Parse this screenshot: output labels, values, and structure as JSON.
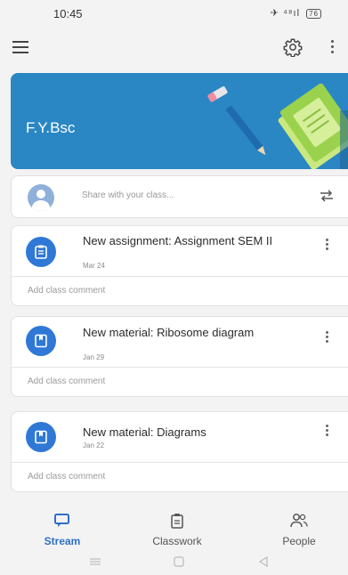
{
  "status_bar": {
    "time": "10:45",
    "signal": "✈ ⁴⁸ıl",
    "battery": "76"
  },
  "class": {
    "name": "F.Y.Bsc"
  },
  "composer": {
    "placeholder": "Share with your class..."
  },
  "posts": [
    {
      "title": "New assignment: Assignment SEM II",
      "date": "Mar 24",
      "comment": "Add class comment",
      "type": "assignment"
    },
    {
      "title": "New material: Ribosome diagram",
      "date": "Jan 29",
      "comment": "Add class comment",
      "type": "material"
    },
    {
      "title": "New material: Diagrams",
      "date": "Jan 22",
      "comment": "Add class comment",
      "type": "material"
    }
  ],
  "nav": {
    "stream": "Stream",
    "classwork": "Classwork",
    "people": "People"
  },
  "colors": {
    "accent": "#2f6fc7",
    "banner": "#2a87c4",
    "icon_bg": "#2f78d5"
  },
  "icons": [
    "menu-icon",
    "gear-icon",
    "more-vert-icon",
    "swap-icon",
    "assignment-icon",
    "material-icon",
    "stream-icon",
    "classwork-icon",
    "people-icon"
  ]
}
